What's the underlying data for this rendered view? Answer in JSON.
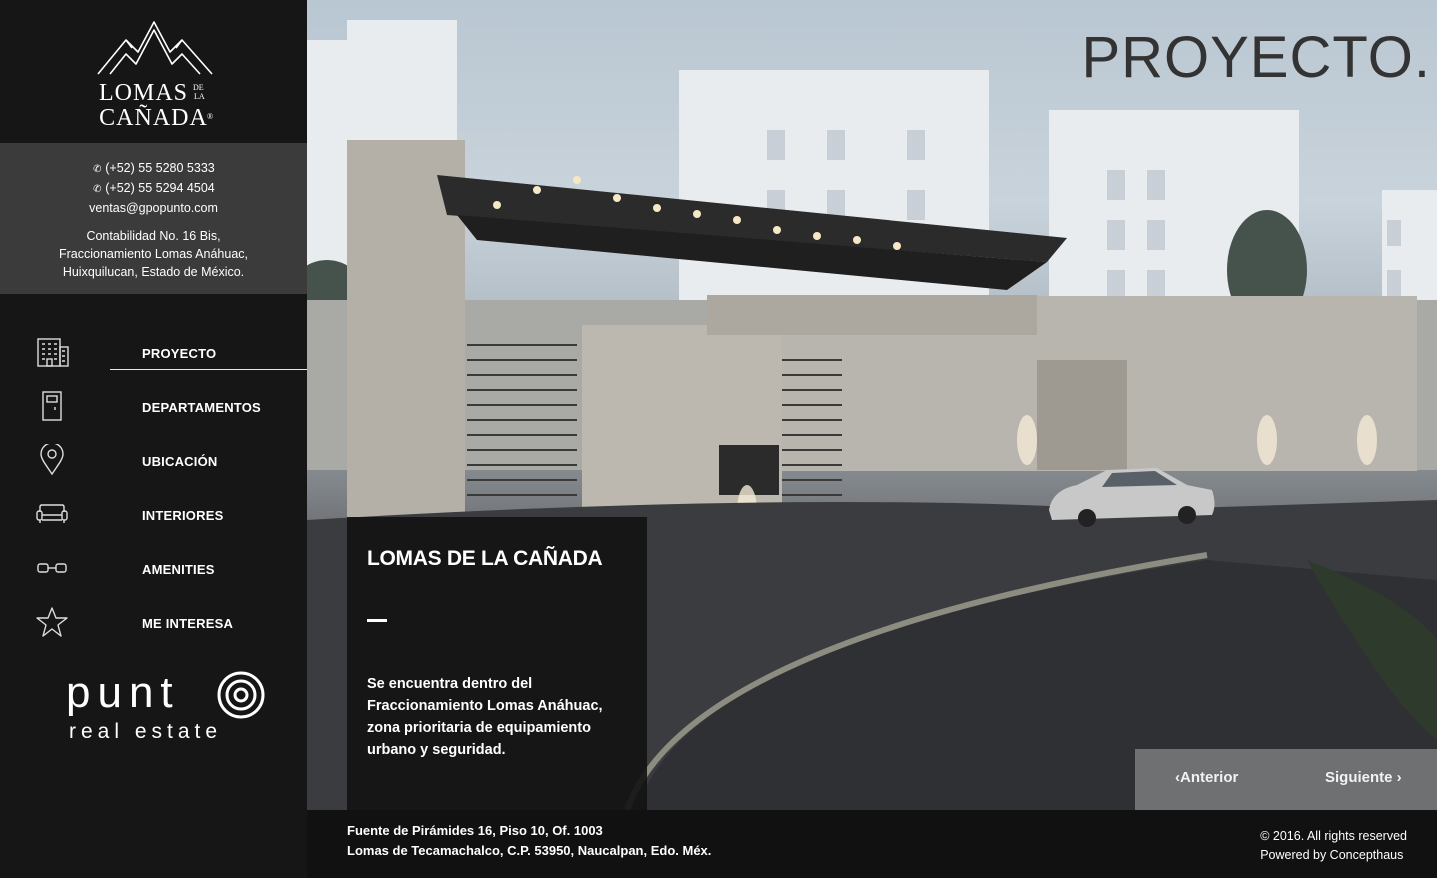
{
  "brand": {
    "logo_line1": "LOMAS",
    "logo_de": "DE",
    "logo_la": "LA",
    "logo_line2": "CAÑADA",
    "logo_mark": "®"
  },
  "contact": {
    "phone1": "(+52) 55 5280 5333",
    "phone2": "(+52) 55 5294 4504",
    "email": "ventas@gpopunto.com",
    "address_line1": "Contabilidad No. 16 Bis,",
    "address_line2": "Fraccionamiento Lomas Anáhuac,",
    "address_line3": "Huixquilucan, Estado de México."
  },
  "nav": {
    "items": [
      {
        "label": "PROYECTO",
        "icon": "building-icon",
        "active": true
      },
      {
        "label": "DEPARTAMENTOS",
        "icon": "door-icon",
        "active": false
      },
      {
        "label": "UBICACIÓN",
        "icon": "map-pin-icon",
        "active": false
      },
      {
        "label": "INTERIORES",
        "icon": "sofa-icon",
        "active": false
      },
      {
        "label": "AMENITIES",
        "icon": "glasses-icon",
        "active": false
      },
      {
        "label": "ME INTERESA",
        "icon": "star-icon",
        "active": false
      }
    ]
  },
  "partner": {
    "name": "punt",
    "tagline": "real estate"
  },
  "hero": {
    "heading": "PROYECTO."
  },
  "card": {
    "title": "LOMAS DE LA CAÑADA",
    "body": "Se encuentra dentro del Fraccionamiento Lomas Anáhuac, zona prioritaria de equipamiento urbano y seguridad."
  },
  "pager": {
    "prev": "Anterior",
    "next": "Siguiente"
  },
  "footer": {
    "address_line1": "Fuente de Pirámides 16, Piso 10, Of. 1003",
    "address_line2": "Lomas de Tecamachalco, C.P. 53950, Naucalpan, Edo. Méx.",
    "copyright": "© 2016. All rights reserved",
    "powered": "Powered by Concepthaus"
  },
  "colors": {
    "sidebar_bg": "#161616",
    "contact_bg": "#3b3b3b",
    "heading": "#333333"
  }
}
